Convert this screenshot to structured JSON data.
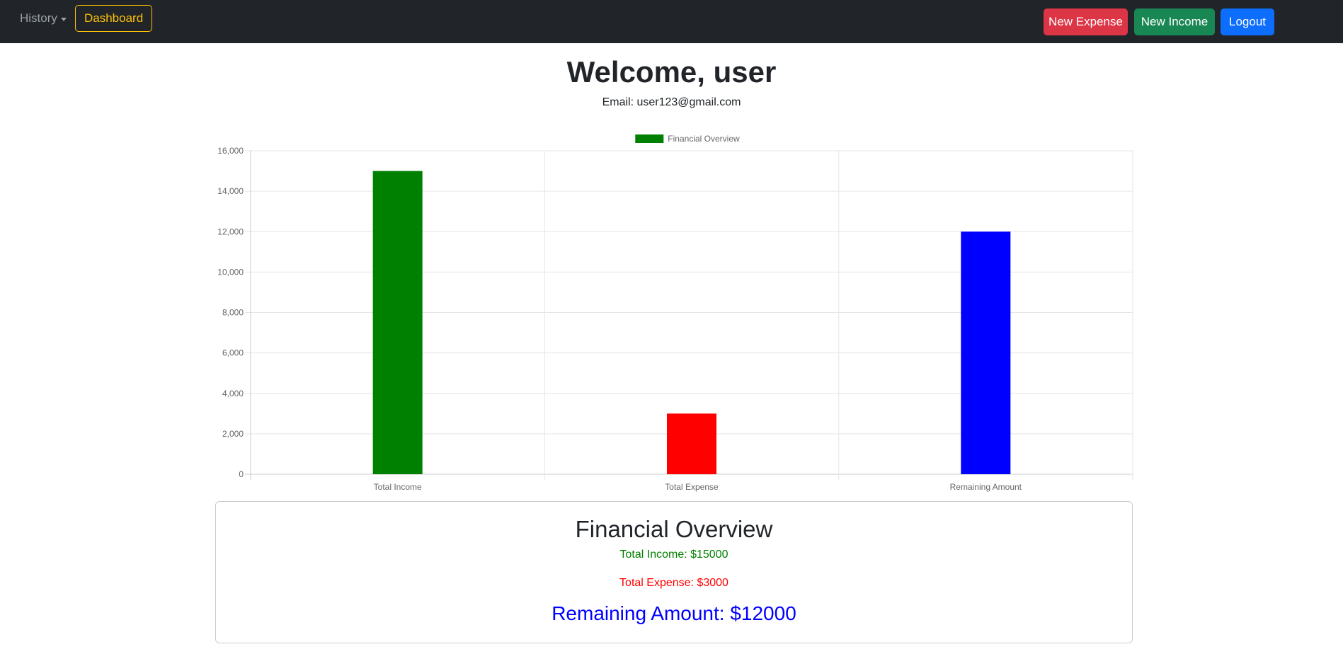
{
  "navbar": {
    "history_label": "History",
    "dashboard_label": "Dashboard",
    "new_expense_label": "New Expense",
    "new_income_label": "New Income",
    "logout_label": "Logout"
  },
  "header": {
    "welcome": "Welcome, user",
    "email": "Email: user123@gmail.com"
  },
  "chart_data": {
    "type": "bar",
    "categories": [
      "Total Income",
      "Total Expense",
      "Remaining Amount"
    ],
    "series": [
      {
        "name": "Financial Overview",
        "values": [
          15000,
          3000,
          12000
        ]
      }
    ],
    "bar_colors": [
      "#008000",
      "#ff0000",
      "#0000ff"
    ],
    "legend_color": "#008000",
    "ylim": [
      0,
      16000
    ],
    "yticks": [
      0,
      2000,
      4000,
      6000,
      8000,
      10000,
      12000,
      14000,
      16000
    ],
    "ytick_labels": [
      "0",
      "2,000",
      "4,000",
      "6,000",
      "8,000",
      "10,000",
      "12,000",
      "14,000",
      "16,000"
    ],
    "grid": true,
    "legend_position": "top"
  },
  "summary": {
    "title": "Financial Overview",
    "income": "Total Income: $15000",
    "expense": "Total Expense: $3000",
    "remaining": "Remaining Amount: $12000"
  }
}
